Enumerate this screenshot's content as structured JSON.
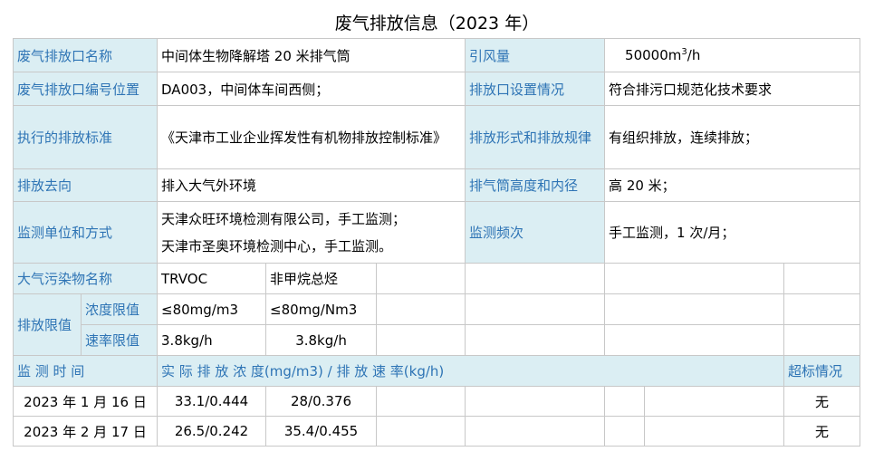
{
  "title": "废气排放信息（2023 年）",
  "rows": {
    "outlet_name_label": "废气排放口名称",
    "outlet_name_value": "中间体生物降解塔 20 米排气筒",
    "airflow_label": "引风量",
    "airflow_value": "50000m",
    "airflow_sup": "3",
    "airflow_unit": "/h",
    "outlet_code_label": "废气排放口编号位置",
    "outlet_code_value": "DA003，中间体车间西侧；",
    "outlet_setting_label": "排放口设置情况",
    "outlet_setting_value": "符合排污口规范化技术要求",
    "standard_label": "执行的排放标准",
    "standard_value": "《天津市工业企业挥发性有机物排放控制标准》",
    "emission_mode_label": "排放形式和排放规律",
    "emission_mode_value": "有组织排放，连续排放；",
    "destination_label": "排放去向",
    "destination_value": "排入大气外环境",
    "stack_label": "排气筒高度和内径",
    "stack_value": "高 20 米；",
    "monitor_unit_label": "监测单位和方式",
    "monitor_unit_line1": "天津众旺环境检测有限公司，手工监测；",
    "monitor_unit_line2": "天津市圣奥环境检测中心，手工监测。",
    "frequency_label": "监测频次",
    "frequency_value": "手工监测，1 次/月；",
    "pollutant_label": "大气污染物名称",
    "pollutant_1": "TRVOC",
    "pollutant_2": "非甲烷总烃",
    "limit_label": "排放限值",
    "conc_limit_label": "浓度限值",
    "conc_limit_1": "≤80mg/m3",
    "conc_limit_2": "≤80mg/Nm3",
    "rate_limit_label": "速率限值",
    "rate_limit_1": "3.8kg/h",
    "rate_limit_2": "3.8kg/h",
    "time_header": "监 测 时 间",
    "actual_header": "实 际 排 放 浓 度(mg/m3) / 排 放 速 率(kg/h)",
    "exceed_header": "超标情况"
  },
  "measurements": [
    {
      "date": "2023 年 1 月 16 日",
      "v1": "33.1/0.444",
      "v2": "28/0.376",
      "exceed": "无"
    },
    {
      "date": "2023 年 2 月 17 日",
      "v1": "26.5/0.242",
      "v2": "35.4/0.455",
      "exceed": "无"
    }
  ]
}
